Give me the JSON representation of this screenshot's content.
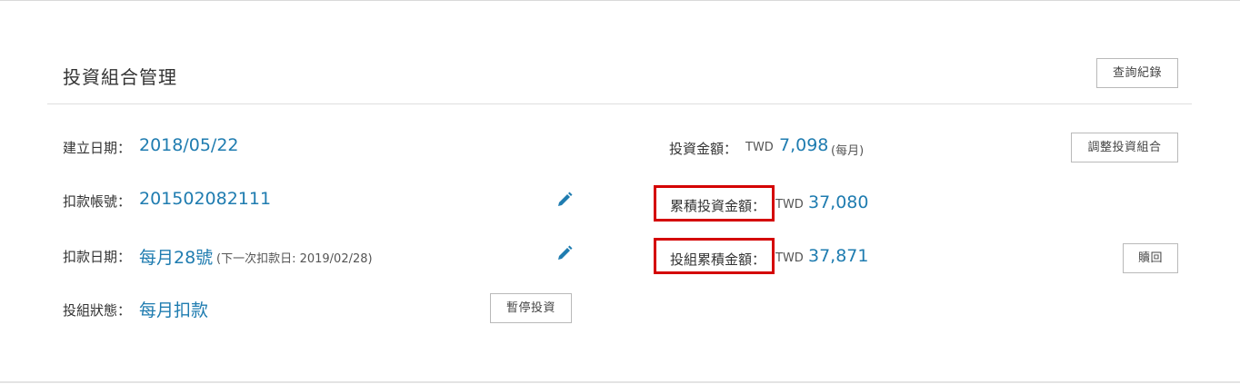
{
  "panel": {
    "title": "投資組合管理",
    "history_button": "查詢紀錄"
  },
  "left": {
    "created_label": "建立日期：",
    "created_value": "2018/05/22",
    "account_label": "扣款帳號：",
    "account_value": "201502082111",
    "debit_label": "扣款日期：",
    "debit_value": "每月28號",
    "debit_note": "(下一次扣款日: 2019/02/28)",
    "status_label": "投組狀態：",
    "status_value": "每月扣款",
    "pause_button": "暫停投資"
  },
  "right": {
    "amount_label": "投資金額：",
    "amount_currency": "TWD",
    "amount_value": "7,098",
    "amount_note": "(每月)",
    "adjust_button": "調整投資組合",
    "accum_invest_label": "累積投資金額：",
    "accum_invest_currency": "TWD",
    "accum_invest_value": "37,080",
    "accum_total_label": "投組累積金額：",
    "accum_total_currency": "TWD",
    "accum_total_value": "37,871",
    "redeem_button": "贖回"
  },
  "icons": {
    "edit": "pencil-icon"
  },
  "colors": {
    "value_blue": "#1f7cb0",
    "highlight_red": "#d40000",
    "edit_icon_blue": "#1f7cb0"
  }
}
